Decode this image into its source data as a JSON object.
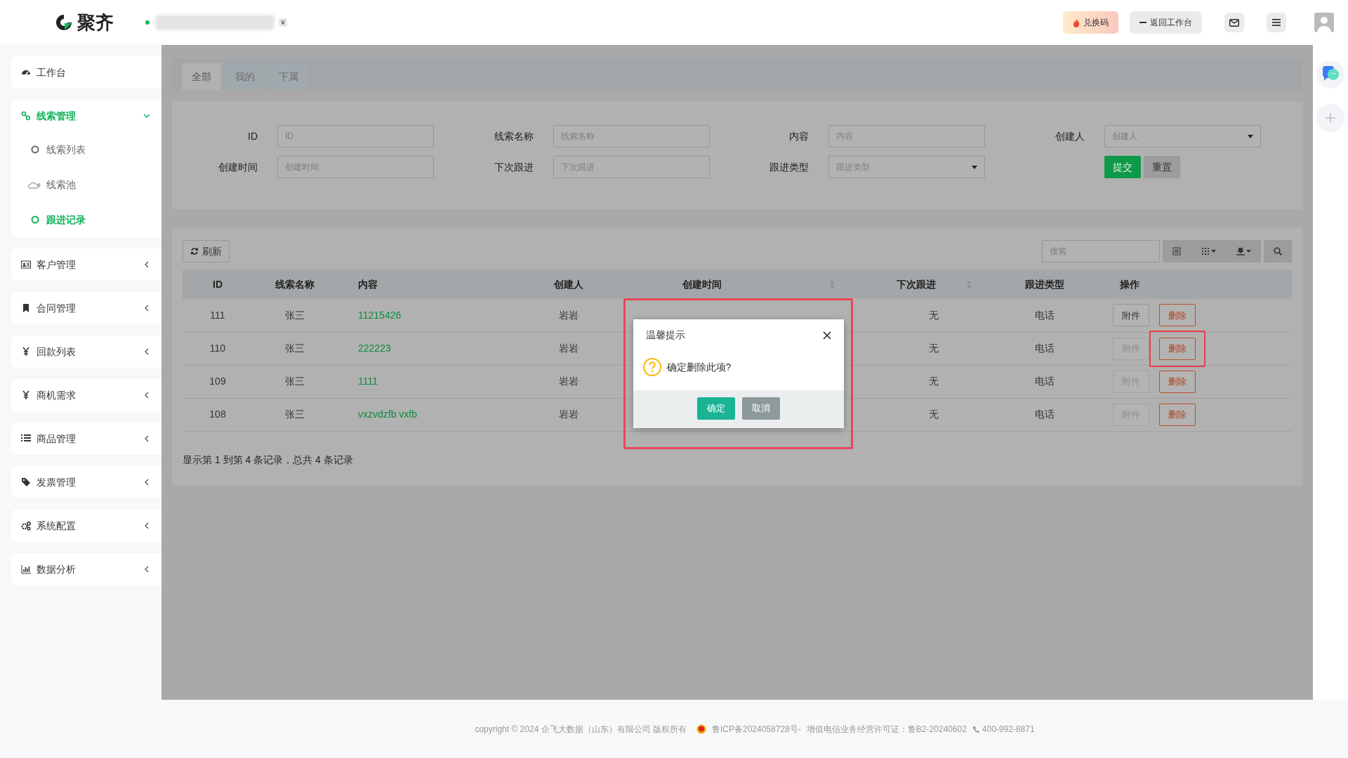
{
  "header": {
    "logo": "聚齐",
    "actions": [
      {
        "label": "兑换码",
        "kind": "redeem"
      },
      {
        "label": "返回工作台",
        "kind": "back"
      }
    ]
  },
  "sidebar": [
    {
      "label": "工作台",
      "expanded": false,
      "has_menu": false
    },
    {
      "label": "线索管理",
      "expanded": true,
      "has_menu": true,
      "children": [
        {
          "label": "线索列表",
          "selected": false
        },
        {
          "label": "线索池",
          "selected": false
        },
        {
          "label": "跟进记录",
          "selected": true
        }
      ]
    },
    {
      "label": "客户管理",
      "expanded": false,
      "has_menu": true
    },
    {
      "label": "合同管理",
      "expanded": false,
      "has_menu": true
    },
    {
      "label": "回款列表",
      "expanded": false,
      "has_menu": true
    },
    {
      "label": "商机需求",
      "expanded": false,
      "has_menu": true
    },
    {
      "label": "商品管理",
      "expanded": false,
      "has_menu": true
    },
    {
      "label": "发票管理",
      "expanded": false,
      "has_menu": true
    },
    {
      "label": "系统配置",
      "expanded": false,
      "has_menu": true
    },
    {
      "label": "数据分析",
      "expanded": false,
      "has_menu": true
    }
  ],
  "tabs": [
    {
      "label": "全部",
      "selected": true
    },
    {
      "label": "我的",
      "selected": false
    },
    {
      "label": "下属",
      "selected": false
    }
  ],
  "filters": [
    {
      "label": "ID",
      "placeholder": "ID",
      "kind": "text"
    },
    {
      "label": "线索名称",
      "placeholder": "线索名称",
      "kind": "text"
    },
    {
      "label": "内容",
      "placeholder": "内容",
      "kind": "text"
    },
    {
      "label": "创建人",
      "placeholder": "创建人",
      "kind": "select"
    },
    {
      "label": "创建时间",
      "placeholder": "创建时间",
      "kind": "text"
    },
    {
      "label": "下次跟进",
      "placeholder": "下次跟进",
      "kind": "text"
    },
    {
      "label": "跟进类型",
      "placeholder": "跟进类型",
      "kind": "select"
    }
  ],
  "filter_buttons": [
    {
      "label": "提交",
      "kind": "primary"
    },
    {
      "label": "重置",
      "kind": "secondary"
    }
  ],
  "toolbar": {
    "refresh": "刷新",
    "search_placeholder": "搜索"
  },
  "table": {
    "columns": [
      {
        "label": "ID",
        "sortable": false
      },
      {
        "label": "线索名称",
        "sortable": false
      },
      {
        "label": "内容",
        "sortable": false
      },
      {
        "label": "创建人",
        "sortable": false
      },
      {
        "label": "创建时间",
        "sortable": true
      },
      {
        "label": "下次跟进",
        "sortable": true
      },
      {
        "label": "跟进类型",
        "sortable": false
      },
      {
        "label": "操作",
        "sortable": false
      }
    ],
    "rows": [
      {
        "id": "111",
        "name": "张三",
        "content": "11215426",
        "creator": "岩岩",
        "next": "无",
        "type": "电话",
        "actions": [
          {
            "label": "附件",
            "disabled": false
          },
          {
            "label": "删除",
            "disabled": false
          }
        ]
      },
      {
        "id": "110",
        "name": "张三",
        "content": "222223",
        "creator": "岩岩",
        "next": "无",
        "type": "电话",
        "actions": [
          {
            "label": "附件",
            "disabled": true
          },
          {
            "label": "删除",
            "disabled": false,
            "highlighted": true
          }
        ]
      },
      {
        "id": "109",
        "name": "张三",
        "content": "1111",
        "creator": "岩岩",
        "next": "无",
        "type": "电话",
        "actions": [
          {
            "label": "附件",
            "disabled": true
          },
          {
            "label": "删除",
            "disabled": false
          }
        ]
      },
      {
        "id": "108",
        "name": "张三",
        "content": "vxzvdzfb vxfb",
        "creator": "岩岩",
        "next": "无",
        "type": "电话",
        "actions": [
          {
            "label": "附件",
            "disabled": true
          },
          {
            "label": "删除",
            "disabled": false
          }
        ]
      }
    ]
  },
  "summary": "显示第 1 到第 4 条记录，总共 4 条记录",
  "modal": {
    "title": "温馨提示",
    "message": "确定删除此项?",
    "highlighted": true,
    "buttons": [
      {
        "label": "确定",
        "kind": "primary"
      },
      {
        "label": "取消",
        "kind": "secondary"
      }
    ]
  },
  "footer": {
    "copyright": "copyright © 2024 企飞大数据（山东）有限公司 版权所有",
    "icp": "鲁ICP备2024058728号-",
    "license": "增值电信业务经营许可证：鲁B2-20240602",
    "phone": "400-992-8871"
  }
}
